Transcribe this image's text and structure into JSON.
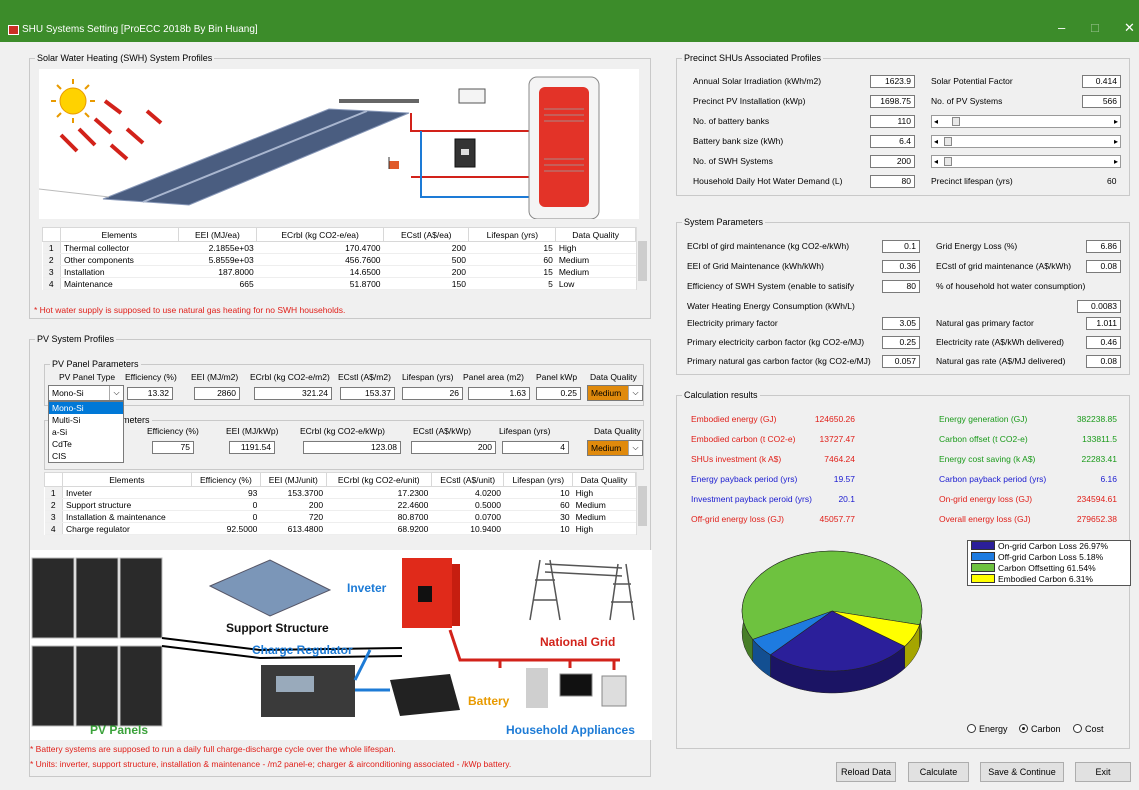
{
  "window": {
    "title": "SHU Systems Setting [ProECC 2018b By Bin Huang]",
    "min": "–",
    "max": "□",
    "close": "✕"
  },
  "swh": {
    "title": "Solar Water Heating (SWH) System Profiles",
    "columns": [
      "",
      "Elements",
      "EEI (MJ/ea)",
      "ECrbl (kg CO2-e/ea)",
      "ECstl (A$/ea)",
      "Lifespan (yrs)",
      "Data Quality"
    ],
    "rows": [
      [
        "1",
        "Thermal collector",
        "2.1855e+03",
        "170.4700",
        "200",
        "15",
        "High"
      ],
      [
        "2",
        "Other components",
        "5.8559e+03",
        "456.7600",
        "500",
        "60",
        "Medium"
      ],
      [
        "3",
        "Installation",
        "187.8000",
        "14.6500",
        "200",
        "15",
        "Medium"
      ],
      [
        "4",
        "Maintenance",
        "665",
        "51.8700",
        "150",
        "5",
        "Low"
      ]
    ],
    "note": "* Hot water supply is supposed to use natural gas heating for no SWH households."
  },
  "pv": {
    "title": "PV System Profiles",
    "panel_group": "PV Panel Parameters",
    "panel_headers": [
      "PV Panel Type",
      "Efficiency (%)",
      "EEI (MJ/m2)",
      "ECrbl (kg CO2-e/m2)",
      "ECstl (A$/m2)",
      "Lifespan (yrs)",
      "Panel area (m2)",
      "Panel kWp",
      "Data Quality"
    ],
    "panel_type": "Mono-Si",
    "panel_eff": "13.32",
    "panel_eei": "2860",
    "panel_ecrbl": "321.24",
    "panel_ecstl": "153.37",
    "panel_life": "26",
    "panel_area": "1.63",
    "panel_kwp": "0.25",
    "panel_dq": "Medium",
    "type_options": [
      "Mono-Si",
      "Multi-Si",
      "a-Si",
      "CdTe",
      "CIS"
    ],
    "batt_group": "ameters",
    "batt_headers": [
      "Efficiency (%)",
      "EEI (MJ/kWp)",
      "ECrbl (kg CO2-e/kWp)",
      "ECstl (A$/kWp)",
      "Lifespan (yrs)",
      "Data Quality"
    ],
    "batt_eff": "75",
    "batt_eei": "1191.54",
    "batt_ecrbl": "123.08",
    "batt_ecstl": "200",
    "batt_life": "4",
    "batt_dq": "Medium",
    "columns": [
      "",
      "Elements",
      "Efficiency (%)",
      "EEI (MJ/unit)",
      "ECrbl (kg CO2-e/unit)",
      "ECstl (A$/unit)",
      "Lifespan (yrs)",
      "Data Quality"
    ],
    "rows": [
      [
        "1",
        "Inveter",
        "93",
        "153.3700",
        "17.2300",
        "4.0200",
        "10",
        "High"
      ],
      [
        "2",
        "Support structure",
        "0",
        "200",
        "22.4600",
        "0.5000",
        "60",
        "Medium"
      ],
      [
        "3",
        "Installation & maintenance",
        "0",
        "720",
        "80.8700",
        "0.0700",
        "30",
        "Medium"
      ],
      [
        "4",
        "Charge regulator",
        "92.5000",
        "613.4800",
        "68.9200",
        "10.9400",
        "10",
        "High"
      ]
    ],
    "diagram": {
      "inveter": "Inveter",
      "support": "Support Structure",
      "charge": "Charge Regulator",
      "grid": "National Grid",
      "battery": "Battery",
      "panels": "PV Panels",
      "appliances": "Household Appliances"
    },
    "note1": "* Battery systems are supposed to run a daily full charge-discharge cycle over the whole lifespan.",
    "note2": "* Units: inverter, support structure, installation & maintenance - /m2 panel-e; charger & airconditioning associated - /kWp battery."
  },
  "precinct": {
    "title": "Precinct SHUs Associated Profiles",
    "irr_label": "Annual Solar Irradiation (kWh/m2)",
    "irr": "1623.9",
    "spf_label": "Solar Potential Factor",
    "spf": "0.414",
    "pvi_label": "Precinct PV Installation (kWp)",
    "pvi": "1698.75",
    "npv_label": "No. of PV Systems",
    "npv": "566",
    "nbb_label": "No. of battery banks",
    "nbb": "110",
    "bbs_label": "Battery bank size (kWh)",
    "bbs": "6.4",
    "nswh_label": "No. of SWH Systems",
    "nswh": "200",
    "hw_label": "Household Daily Hot Water Demand (L)",
    "hw": "80",
    "life_label": "Precinct lifespan (yrs)",
    "life": "60"
  },
  "sys": {
    "title": "System Parameters",
    "l1": "ECrbl of gird maintenance (kg CO2-e/kWh)",
    "v1": "0.1",
    "l2": "Grid Energy Loss (%)",
    "v2": "6.86",
    "l3": "EEI of Grid Maintenance (kWh/kWh)",
    "v3": "0.36",
    "l4": "ECstl of grid maintenance (A$/kWh)",
    "v4": "0.08",
    "l5": "Efficiency of SWH System (enable to satisify",
    "v5": "80",
    "l6": "% of household hot water consumption)",
    "l7": "Water Heating Energy Consumption (kWh/L)",
    "v7": "0.0083",
    "l8": "Electricity primary factor",
    "v8": "3.05",
    "l9": "Natural gas primary factor",
    "v9": "1.011",
    "l10": "Primary electricity carbon factor (kg CO2-e/MJ)",
    "v10": "0.25",
    "l11": "Electricity rate (A$/kWh delivered)",
    "v11": "0.46",
    "l12": "Primary natural gas carbon factor (kg CO2-e/MJ)",
    "v12": "0.057",
    "l13": "Natural gas rate (A$/MJ delivered)",
    "v13": "0.08"
  },
  "results": {
    "title": "Calculation results",
    "items": [
      {
        "label": "Embodied energy (GJ)",
        "value": "124650.26",
        "color": "#e0201a"
      },
      {
        "label": "Energy generation (GJ)",
        "value": "382238.85",
        "color": "#1a9a1a"
      },
      {
        "label": "Embodied carbon (t CO2-e)",
        "value": "13727.47",
        "color": "#e0201a"
      },
      {
        "label": "Carbon offset (t CO2-e)",
        "value": "133811.5",
        "color": "#1a9a1a"
      },
      {
        "label": "SHUs investment (k A$)",
        "value": "7464.24",
        "color": "#e0201a"
      },
      {
        "label": "Energy cost saving (k A$)",
        "value": "22283.41",
        "color": "#1a9a1a"
      },
      {
        "label": "Energy payback period (yrs)",
        "value": "19.57",
        "color": "#1a1ad0"
      },
      {
        "label": "Carbon payback period (yrs)",
        "value": "6.16",
        "color": "#1a1ad0"
      },
      {
        "label": "Investment payback peroid (yrs)",
        "value": "20.1",
        "color": "#1a1ad0"
      },
      {
        "label": "On-grid energy loss (GJ)",
        "value": "234594.61",
        "color": "#e0201a"
      },
      {
        "label": "Off-grid energy loss (GJ)",
        "value": "45057.77",
        "color": "#e0201a"
      },
      {
        "label": "Overall energy loss (GJ)",
        "value": "279652.38",
        "color": "#e0201a"
      }
    ],
    "legend": [
      {
        "label": "On-grid Carbon Loss  26.97%",
        "color": "#2b1f9a"
      },
      {
        "label": "Off-grid Carbon Loss  5.18%",
        "color": "#1e7be0"
      },
      {
        "label": "Carbon Offsetting  61.54%",
        "color": "#6ec23f"
      },
      {
        "label": "Embodied Carbon  6.31%",
        "color": "#ffff00"
      }
    ],
    "radio": [
      "Energy",
      "Carbon",
      "Cost"
    ],
    "selected": "Carbon"
  },
  "chart_data": {
    "type": "pie",
    "categories": [
      "On-grid Carbon Loss",
      "Off-grid Carbon Loss",
      "Carbon Offsetting",
      "Embodied Carbon"
    ],
    "values": [
      26.97,
      5.18,
      61.54,
      6.31
    ],
    "colors": [
      "#2b1f9a",
      "#1e7be0",
      "#6ec23f",
      "#ffff00"
    ]
  },
  "buttons": {
    "reload": "Reload Data",
    "calculate": "Calculate",
    "save": "Save & Continue",
    "exit": "Exit"
  }
}
